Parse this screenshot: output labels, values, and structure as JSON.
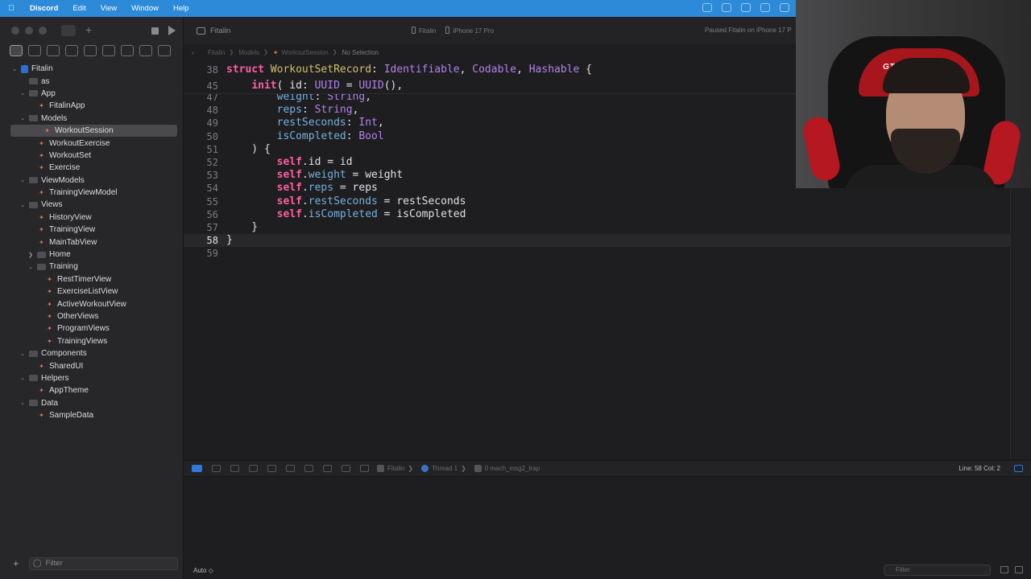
{
  "menubar": {
    "app": "Discord",
    "items": [
      "Edit",
      "View",
      "Window",
      "Help"
    ]
  },
  "sidebar": {
    "filter_placeholder": "Filter",
    "tree": [
      {
        "label": "Fitalin",
        "depth": 0,
        "kind": "project",
        "expanded": true
      },
      {
        "label": "as",
        "depth": 1,
        "kind": "folder"
      },
      {
        "label": "App",
        "depth": 1,
        "kind": "group",
        "expanded": true
      },
      {
        "label": "FitalinApp",
        "depth": 2,
        "kind": "swift"
      },
      {
        "label": "Models",
        "depth": 1,
        "kind": "group",
        "expanded": true
      },
      {
        "label": "WorkoutSession",
        "depth": 2,
        "kind": "swift",
        "selected": true
      },
      {
        "label": "WorkoutExercise",
        "depth": 2,
        "kind": "swift"
      },
      {
        "label": "WorkoutSet",
        "depth": 2,
        "kind": "swift"
      },
      {
        "label": "Exercise",
        "depth": 2,
        "kind": "swift"
      },
      {
        "label": "ViewModels",
        "depth": 1,
        "kind": "group",
        "expanded": true
      },
      {
        "label": "TrainingViewModel",
        "depth": 2,
        "kind": "swift"
      },
      {
        "label": "Views",
        "depth": 1,
        "kind": "group",
        "expanded": true
      },
      {
        "label": "HistoryView",
        "depth": 2,
        "kind": "swift"
      },
      {
        "label": "TrainingView",
        "depth": 2,
        "kind": "swift"
      },
      {
        "label": "MainTabView",
        "depth": 2,
        "kind": "swift"
      },
      {
        "label": "Home",
        "depth": 2,
        "kind": "group",
        "expanded": false
      },
      {
        "label": "Training",
        "depth": 2,
        "kind": "group",
        "expanded": true
      },
      {
        "label": "RestTimerView",
        "depth": 3,
        "kind": "swift"
      },
      {
        "label": "ExerciseListView",
        "depth": 3,
        "kind": "swift"
      },
      {
        "label": "ActiveWorkoutView",
        "depth": 3,
        "kind": "swift"
      },
      {
        "label": "OtherViews",
        "depth": 3,
        "kind": "swift"
      },
      {
        "label": "ProgramViews",
        "depth": 3,
        "kind": "swift"
      },
      {
        "label": "TrainingViews",
        "depth": 3,
        "kind": "swift"
      },
      {
        "label": "Components",
        "depth": 1,
        "kind": "group",
        "expanded": true
      },
      {
        "label": "SharedUI",
        "depth": 2,
        "kind": "swift"
      },
      {
        "label": "Helpers",
        "depth": 1,
        "kind": "group",
        "expanded": true
      },
      {
        "label": "AppTheme",
        "depth": 2,
        "kind": "swift"
      },
      {
        "label": "Data",
        "depth": 1,
        "kind": "group",
        "expanded": true
      },
      {
        "label": "SampleData",
        "depth": 2,
        "kind": "swift"
      }
    ]
  },
  "toolbar": {
    "project_tab": "Fitalin",
    "scheme": "Fitalin",
    "device": "iPhone 17 Pro",
    "status": "Paused Fitalin on iPhone 17 P"
  },
  "jumpbar": {
    "crumbs": [
      "Fitalin",
      "Models",
      "WorkoutSession",
      "No Selection"
    ]
  },
  "editor": {
    "sticky": [
      {
        "num": "38",
        "html": "<span class='kw'>struct</span> <span class='ty'>WorkoutSetRecord</span>: <span class='ty2'>Identifiable</span>, <span class='ty2'>Codable</span>, <span class='ty2'>Hashable</span> {"
      },
      {
        "num": "45",
        "html": "    <span class='kw'>init</span>( id: <span class='ty2'>UUID</span> = <span class='ty2'>UUID</span>(),"
      }
    ],
    "lines": [
      {
        "num": "47",
        "html": "        <span class='prop'>weight</span>: <span class='ty2'>String</span>,"
      },
      {
        "num": "48",
        "html": "        <span class='prop'>reps</span>: <span class='ty2'>String</span>,"
      },
      {
        "num": "49",
        "html": "        <span class='prop'>restSeconds</span>: <span class='ty2'>Int</span>,"
      },
      {
        "num": "50",
        "html": "        <span class='prop'>isCompleted</span>: <span class='ty2'>Bool</span>"
      },
      {
        "num": "51",
        "html": "    ) {"
      },
      {
        "num": "52",
        "html": "        <span class='kw'>self</span>.id = id"
      },
      {
        "num": "53",
        "html": "        <span class='kw'>self</span>.<span class='prop'>weight</span> = weight"
      },
      {
        "num": "54",
        "html": "        <span class='kw'>self</span>.<span class='prop'>reps</span> = reps"
      },
      {
        "num": "55",
        "html": "        <span class='kw'>self</span>.<span class='prop'>restSeconds</span> = restSeconds"
      },
      {
        "num": "56",
        "html": "        <span class='kw'>self</span>.<span class='prop'>isCompleted</span> = isCompleted"
      },
      {
        "num": "57",
        "html": "    }"
      },
      {
        "num": "58",
        "html": "}",
        "current": true
      },
      {
        "num": "59",
        "html": ""
      }
    ]
  },
  "debugbar": {
    "frames": [
      "Fitalin",
      "Thread 1",
      "0 mach_msg2_trap"
    ],
    "position": "Line: 58  Col: 2"
  },
  "console": {
    "mode": "Auto ◇",
    "filter_placeholder": "Filter"
  },
  "webcam": {
    "chair_brand": "GTR"
  },
  "colors": {
    "menubar": "#2d8ad8",
    "keyword": "#fc5fa3",
    "type": "#b281eb",
    "decl_type": "#d0bf69",
    "property": "#74b0df",
    "accent": "#2f7ad8"
  }
}
